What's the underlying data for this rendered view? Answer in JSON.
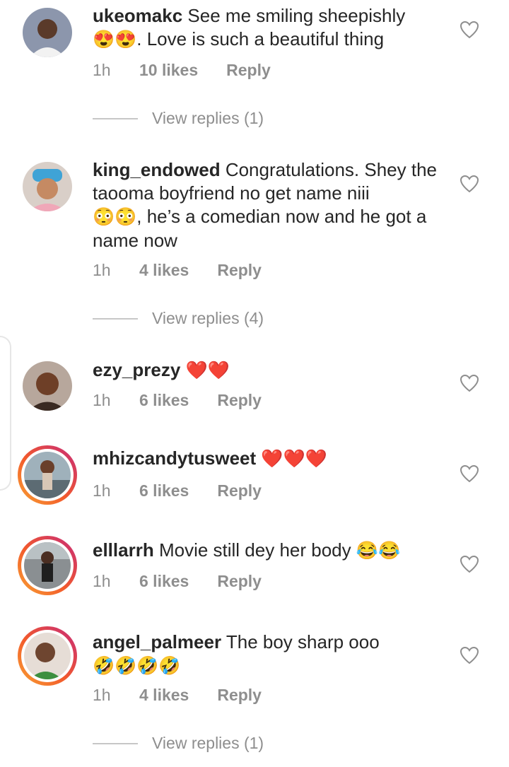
{
  "comments": [
    {
      "username": "ukeomakc",
      "text": "See me smiling sheepishly",
      "text2": ". Love is such a beautiful thing",
      "emoji": "😍😍",
      "time": "1h",
      "likes": "10 likes",
      "reply": "Reply",
      "view_replies": "View replies (1)"
    },
    {
      "username": "king_endowed",
      "text": "Congratulations.  Shey the taooma boyfriend no get name niii",
      "emoji": "😳😳",
      "text2": ", he’s a comedian now and he got a name now",
      "time": "1h",
      "likes": "4 likes",
      "reply": "Reply",
      "view_replies": "View replies (4)"
    },
    {
      "username": "ezy_prezy",
      "emoji": "❤️❤️",
      "time": "1h",
      "likes": "6 likes",
      "reply": "Reply"
    },
    {
      "username": "mhizcandytusweet",
      "emoji": "❤️❤️❤️",
      "time": "1h",
      "likes": "6 likes",
      "reply": "Reply"
    },
    {
      "username": "elllarrh",
      "text": "Movie still dey her body",
      "emoji": "😂😂",
      "time": "1h",
      "likes": "6 likes",
      "reply": "Reply"
    },
    {
      "username": "angel_palmeer",
      "text": "The boy sharp ooo",
      "emoji": "🤣🤣🤣🤣",
      "time": "1h",
      "likes": "4 likes",
      "reply": "Reply",
      "view_replies": "View replies (1)"
    }
  ],
  "icons": {
    "like": "heart-outline-icon"
  },
  "colors": {
    "text": "#262626",
    "muted": "#8e8e8e",
    "ring_start": "#f9a332",
    "ring_end": "#c72a7a"
  }
}
